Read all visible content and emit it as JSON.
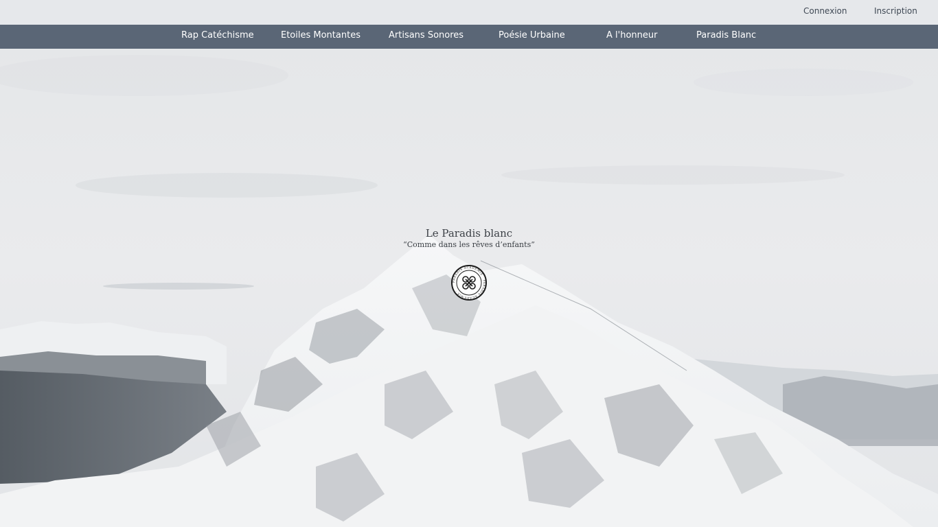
{
  "auth": {
    "login_label": "Connexion",
    "register_label": "Inscription"
  },
  "nav": {
    "items": [
      {
        "label": "Rap Catéchisme"
      },
      {
        "label": "Etoiles Montantes"
      },
      {
        "label": "Artisans Sonores"
      },
      {
        "label": "Poésie Urbaine"
      },
      {
        "label": "A l'honneur"
      },
      {
        "label": "Paradis Blanc"
      }
    ]
  },
  "hero": {
    "title": "Le Paradis blanc",
    "subtitle": "“Comme dans les rêves d’enfants”",
    "logo_text": "PARADIS ACADEMIE"
  },
  "colors": {
    "nav_background": "#5a6676",
    "nav_text": "#ffffff",
    "sky": "#e7e9eb",
    "snow": "#f3f4f5",
    "rock": "#8d9298",
    "forest": "#5b6268"
  },
  "icons": {
    "logo": "paradis-academie-seal-icon"
  }
}
